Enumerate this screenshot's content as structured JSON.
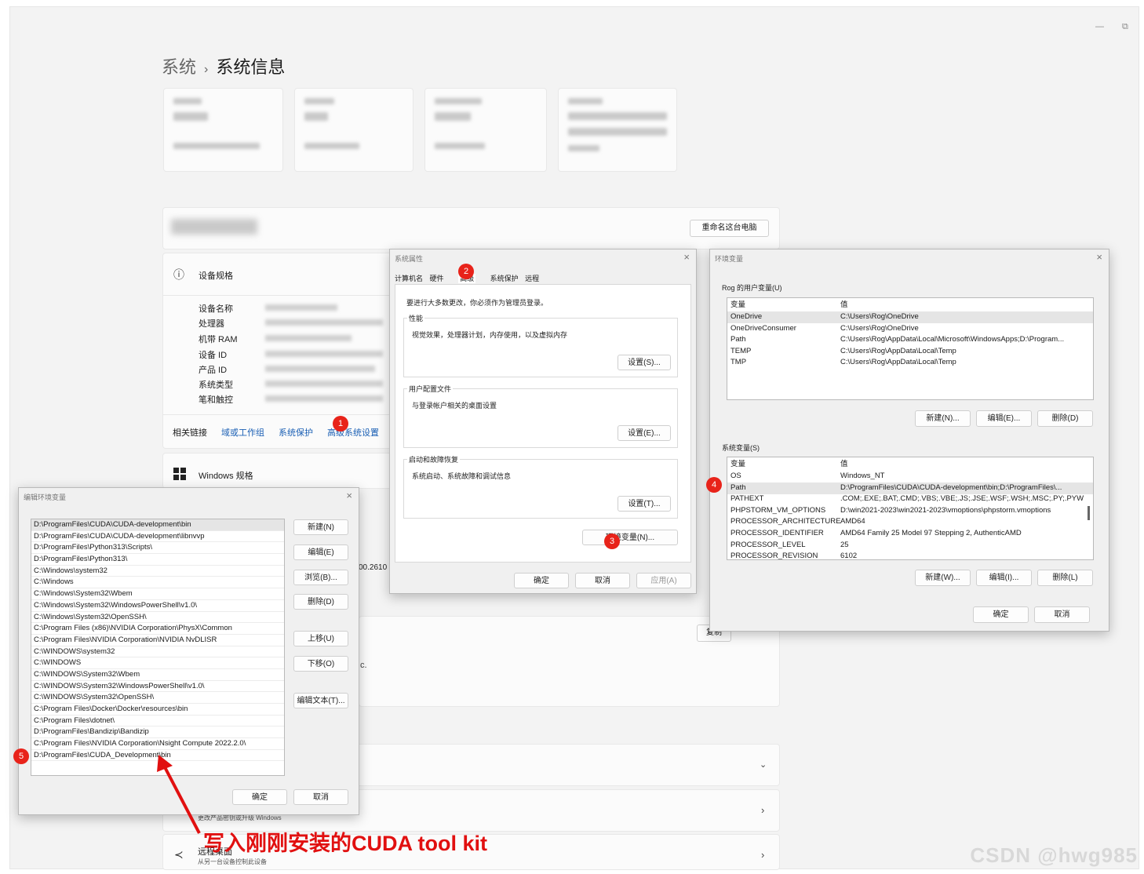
{
  "settings": {
    "breadcrumb_parent": "系统",
    "breadcrumb_sep": "›",
    "breadcrumb_current": "系统信息",
    "rename_button": "重命名这台电脑",
    "device_spec_title": "设备规格",
    "spec_labels": [
      "设备名称",
      "处理器",
      "机带 RAM",
      "设备 ID",
      "产品 ID",
      "系统类型",
      "笔和触控"
    ],
    "related_label": "相关链接",
    "related_links": [
      "域或工作组",
      "系统保护",
      "高级系统设置"
    ],
    "windows_spec_title": "Windows 规格",
    "partial_version": "00.2610",
    "copy_button": "复制",
    "partial_c": "c.",
    "product_key_sub": "更改产品密钥或升级 Windows",
    "remote_title": "远程桌面",
    "remote_sub": "从另一台设备控制此设备",
    "win_min": "—",
    "win_restore": "⧉"
  },
  "system_properties": {
    "title": "系统属性",
    "tabs": [
      "计算机名",
      "硬件",
      "高级",
      "系统保护",
      "远程"
    ],
    "admin_note": "要进行大多数更改，你必须作为管理员登录。",
    "performance_label": "性能",
    "performance_desc": "视觉效果，处理器计划，内存使用，以及虚拟内存",
    "performance_btn": "设置(S)...",
    "profile_label": "用户配置文件",
    "profile_desc": "与登录帐户相关的桌面设置",
    "profile_btn": "设置(E)...",
    "startup_label": "启动和故障恢复",
    "startup_desc": "系统启动、系统故障和调试信息",
    "startup_btn": "设置(T)...",
    "env_btn": "环境变量(N)...",
    "ok": "确定",
    "cancel": "取消",
    "apply": "应用(A)"
  },
  "env_vars": {
    "title": "环境变量",
    "user_label": "Rog 的用户变量(U)",
    "col_var": "变量",
    "col_val": "值",
    "user_rows": [
      {
        "var": "OneDrive",
        "val": "C:\\Users\\Rog\\OneDrive"
      },
      {
        "var": "OneDriveConsumer",
        "val": "C:\\Users\\Rog\\OneDrive"
      },
      {
        "var": "Path",
        "val": "C:\\Users\\Rog\\AppData\\Local\\Microsoft\\WindowsApps;D:\\Program..."
      },
      {
        "var": "TEMP",
        "val": "C:\\Users\\Rog\\AppData\\Local\\Temp"
      },
      {
        "var": "TMP",
        "val": "C:\\Users\\Rog\\AppData\\Local\\Temp"
      }
    ],
    "user_new": "新建(N)...",
    "user_edit": "编辑(E)...",
    "user_delete": "删除(D)",
    "system_label": "系统变量(S)",
    "system_rows": [
      {
        "var": "OS",
        "val": "Windows_NT"
      },
      {
        "var": "Path",
        "val": "D:\\ProgramFiles\\CUDA\\CUDA-development\\bin;D:\\ProgramFiles\\..."
      },
      {
        "var": "PATHEXT",
        "val": ".COM;.EXE;.BAT;.CMD;.VBS;.VBE;.JS;.JSE;.WSF;.WSH;.MSC;.PY;.PYW"
      },
      {
        "var": "PHPSTORM_VM_OPTIONS",
        "val": "D:\\win2021-2023\\win2021-2023\\vmoptions\\phpstorm.vmoptions"
      },
      {
        "var": "PROCESSOR_ARCHITECTURE",
        "val": "AMD64"
      },
      {
        "var": "PROCESSOR_IDENTIFIER",
        "val": "AMD64 Family 25 Model 97 Stepping 2, AuthenticAMD"
      },
      {
        "var": "PROCESSOR_LEVEL",
        "val": "25"
      },
      {
        "var": "PROCESSOR_REVISION",
        "val": "6102"
      }
    ],
    "sys_new": "新建(W)...",
    "sys_edit": "编辑(I)...",
    "sys_delete": "删除(L)",
    "ok": "确定",
    "cancel": "取消"
  },
  "edit_env": {
    "title": "编辑环境变量",
    "items": [
      "D:\\ProgramFiles\\CUDA\\CUDA-development\\bin",
      "D:\\ProgramFiles\\CUDA\\CUDA-development\\libnvvp",
      "D:\\ProgramFiles\\Python313\\Scripts\\",
      "D:\\ProgramFiles\\Python313\\",
      "C:\\Windows\\system32",
      "C:\\Windows",
      "C:\\Windows\\System32\\Wbem",
      "C:\\Windows\\System32\\WindowsPowerShell\\v1.0\\",
      "C:\\Windows\\System32\\OpenSSH\\",
      "C:\\Program Files (x86)\\NVIDIA Corporation\\PhysX\\Common",
      "C:\\Program Files\\NVIDIA Corporation\\NVIDIA NvDLISR",
      "C:\\WINDOWS\\system32",
      "C:\\WINDOWS",
      "C:\\WINDOWS\\System32\\Wbem",
      "C:\\WINDOWS\\System32\\WindowsPowerShell\\v1.0\\",
      "C:\\WINDOWS\\System32\\OpenSSH\\",
      "C:\\Program Files\\Docker\\Docker\\resources\\bin",
      "C:\\Program Files\\dotnet\\",
      "D:\\ProgramFiles\\Bandizip\\Bandizip",
      "C:\\Program Files\\NVIDIA Corporation\\Nsight Compute 2022.2.0\\",
      "D:\\ProgramFiles\\CUDA_Development\\bin"
    ],
    "new": "新建(N)",
    "edit": "编辑(E)",
    "browse": "浏览(B)...",
    "delete": "删除(D)",
    "move_up": "上移(U)",
    "move_down": "下移(O)",
    "edit_text": "编辑文本(T)...",
    "ok": "确定",
    "cancel": "取消"
  },
  "annotations": {
    "badges": [
      "1",
      "2",
      "3",
      "4",
      "5"
    ],
    "note": "写入刚刚安装的CUDA tool kit",
    "arrow_color": "#e11010"
  },
  "watermark": "CSDN @hwg985"
}
